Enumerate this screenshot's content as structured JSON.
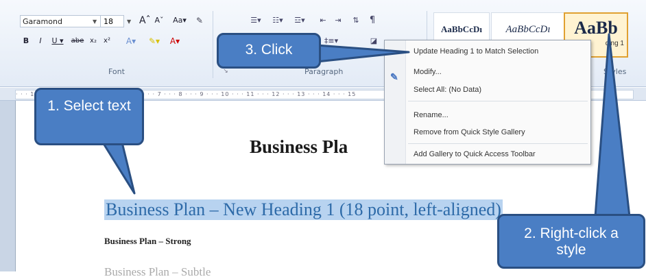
{
  "ribbon": {
    "font_name": "Garamond",
    "font_size": "18",
    "font_group_label": "Font",
    "paragraph_group_label": "Paragraph",
    "styles_group_label": "Styles",
    "styles": [
      {
        "sample": "AaBbCcDı",
        "caption": ""
      },
      {
        "sample": "AaBbCcDı",
        "caption": ""
      },
      {
        "sample": "AaBb",
        "caption": "ding 1"
      }
    ]
  },
  "ruler": {
    "text": "· · · 1 · · · 2 · · · 3 · · · 4 · · · 5 · · · 6 · · · 7 · · · 8 · · · 9 · · · 10 · · · 11 · · · 12 · · · 13 · · · 14 · · · 15"
  },
  "document": {
    "title": "Business Pla",
    "heading1": "Business Plan – New Heading 1 (18 point, left-aligned)",
    "strong": "Business Plan – Strong",
    "subtle": "Business Plan – Subtle"
  },
  "context_menu": {
    "items": [
      "Update Heading 1 to Match Selection",
      "Modify...",
      "Select All: (No Data)",
      "Rename...",
      "Remove from Quick Style Gallery",
      "Add Gallery to Quick Access Toolbar"
    ]
  },
  "callouts": {
    "select": "1. Select text",
    "rightclick": "2. Right-click a style",
    "click": "3. Click"
  },
  "colors": {
    "callout_fill": "#4a7ec4",
    "callout_border": "#2a4f82",
    "selection": "#b8d3f0",
    "heading_text": "#2d6aa8",
    "active_style_border": "#e0a030"
  }
}
